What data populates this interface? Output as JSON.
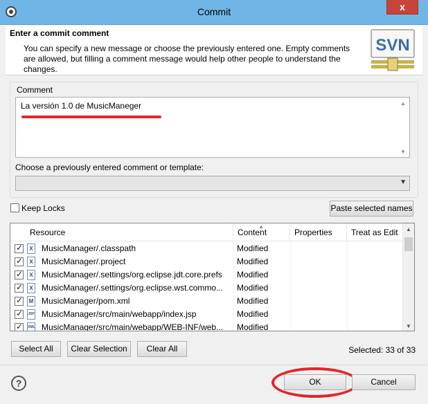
{
  "window": {
    "title": "Commit",
    "close_label": "x"
  },
  "banner": {
    "title": "Enter a commit comment",
    "description": "You can specify a new message or choose the previously entered one. Empty comments are allowed, but filling a comment message would help other people to understand the changes.",
    "logo_text": "SVN"
  },
  "comment": {
    "group_label": "Comment",
    "value": "La versión 1.0 de MusicManeger",
    "annotation_color": "#e3242b"
  },
  "previous": {
    "label": "Choose a previously entered comment or template:",
    "selected": ""
  },
  "options": {
    "keep_locks_label": "Keep Locks",
    "keep_locks_checked": false,
    "paste_button": "Paste selected names"
  },
  "table": {
    "columns": [
      "Resource",
      "Content",
      "Properties",
      "Treat as Edit"
    ],
    "rows": [
      {
        "resource": "MusicManager/.classpath",
        "content": "Modified",
        "properties": "",
        "treat_as_edit": "",
        "icon": "X"
      },
      {
        "resource": "MusicManager/.project",
        "content": "Modified",
        "properties": "",
        "treat_as_edit": "",
        "icon": "X"
      },
      {
        "resource": "MusicManager/.settings/org.eclipse.jdt.core.prefs",
        "content": "Modified",
        "properties": "",
        "treat_as_edit": "",
        "icon": "X"
      },
      {
        "resource": "MusicManager/.settings/org.eclipse.wst.commo...",
        "content": "Modified",
        "properties": "",
        "treat_as_edit": "",
        "icon": "X"
      },
      {
        "resource": "MusicManager/pom.xml",
        "content": "Modified",
        "properties": "",
        "treat_as_edit": "",
        "icon": "M"
      },
      {
        "resource": "MusicManager/src/main/webapp/index.jsp",
        "content": "Modified",
        "properties": "",
        "treat_as_edit": "",
        "icon": "JSP"
      },
      {
        "resource": "MusicManager/src/main/webapp/WEB-INF/web...",
        "content": "Modified",
        "properties": "",
        "treat_as_edit": "",
        "icon": "XML"
      }
    ]
  },
  "table_buttons": {
    "select_all": "Select All",
    "clear_selection": "Clear Selection",
    "clear_all": "Clear All"
  },
  "selection_status": "Selected: 33 of 33",
  "footer": {
    "help": "?",
    "ok": "OK",
    "cancel": "Cancel",
    "ok_highlight_color": "#e3242b"
  }
}
